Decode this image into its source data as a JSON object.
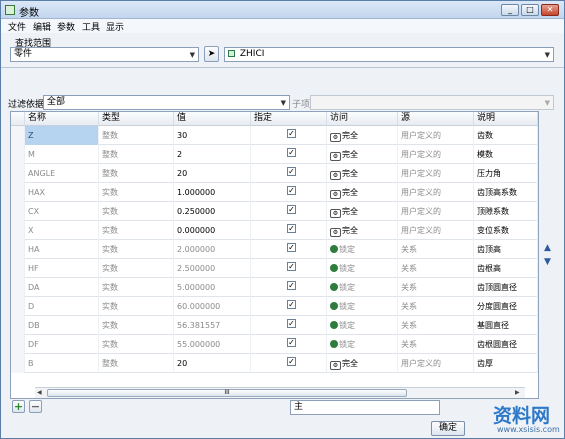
{
  "window": {
    "title": "参数"
  },
  "menu": [
    "文件",
    "编辑",
    "参数",
    "工具",
    "显示"
  ],
  "lookup": {
    "label": "查找范围",
    "scope_value": "零件",
    "model_value": "ZHICI"
  },
  "filter": {
    "label": "过滤依据",
    "value": "全部",
    "subitem_label": "子项",
    "subitem_value": ""
  },
  "columns": [
    "名称",
    "类型",
    "值",
    "指定",
    "访问",
    "源",
    "说明"
  ],
  "rows": [
    {
      "name": "Z",
      "type": "整数",
      "value": "30",
      "designated": true,
      "access": "完全",
      "source": "用户定义的",
      "desc": "齿数",
      "selected": true
    },
    {
      "name": "M",
      "type": "整数",
      "value": "2",
      "designated": true,
      "access": "完全",
      "source": "用户定义的",
      "desc": "模数"
    },
    {
      "name": "ANGLE",
      "type": "整数",
      "value": "20",
      "designated": true,
      "access": "完全",
      "source": "用户定义的",
      "desc": "压力角"
    },
    {
      "name": "HAX",
      "type": "实数",
      "value": "1.000000",
      "designated": true,
      "access": "完全",
      "source": "用户定义的",
      "desc": "齿顶高系数"
    },
    {
      "name": "CX",
      "type": "实数",
      "value": "0.250000",
      "designated": true,
      "access": "完全",
      "source": "用户定义的",
      "desc": "顶隙系数"
    },
    {
      "name": "X",
      "type": "实数",
      "value": "0.000000",
      "designated": true,
      "access": "完全",
      "source": "用户定义的",
      "desc": "变位系数"
    },
    {
      "name": "HA",
      "type": "实数",
      "value": "2.000000",
      "designated": true,
      "access": "锁定",
      "source": "关系",
      "desc": "齿顶高"
    },
    {
      "name": "HF",
      "type": "实数",
      "value": "2.500000",
      "designated": true,
      "access": "锁定",
      "source": "关系",
      "desc": "齿根高"
    },
    {
      "name": "DA",
      "type": "实数",
      "value": "5.000000",
      "designated": true,
      "access": "锁定",
      "source": "关系",
      "desc": "齿顶圆直径"
    },
    {
      "name": "D",
      "type": "实数",
      "value": "60.000000",
      "designated": true,
      "access": "锁定",
      "source": "关系",
      "desc": "分度圆直径"
    },
    {
      "name": "DB",
      "type": "实数",
      "value": "56.381557",
      "designated": true,
      "access": "锁定",
      "source": "关系",
      "desc": "基圆直径"
    },
    {
      "name": "DF",
      "type": "实数",
      "value": "55.000000",
      "designated": true,
      "access": "锁定",
      "source": "关系",
      "desc": "齿根圆直径"
    },
    {
      "name": "B",
      "type": "整数",
      "value": "20",
      "designated": true,
      "access": "完全",
      "source": "用户定义的",
      "desc": "齿厚"
    }
  ],
  "scrollbar_label": "III",
  "bottom": {
    "add": "+",
    "remove": "−",
    "main_value": "主",
    "ok_label": "确定"
  },
  "watermark": {
    "text": "资料网",
    "url": "www.xsisis.com"
  },
  "colors": {
    "locked_icon": "#2e7d3c",
    "selected_row": "#b6d4f0"
  }
}
